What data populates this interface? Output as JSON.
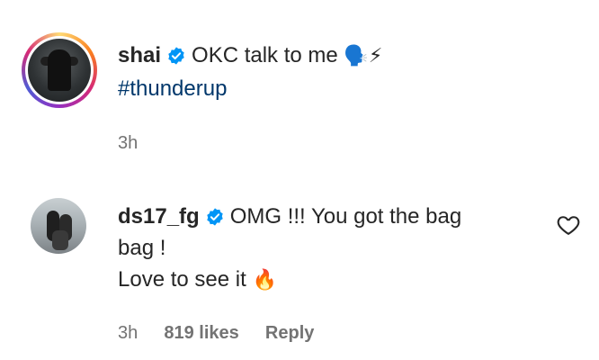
{
  "caption": {
    "username": "shai",
    "text": "OKC talk to me",
    "emoji": "🗣️⚡",
    "hashtag": "#thunderup",
    "time": "3h"
  },
  "comment": {
    "username": "ds17_fg",
    "text_line1": "OMG !!! You got the bag",
    "text_line2": "bag !",
    "text_line3": "Love to see it",
    "emoji": "🔥",
    "time": "3h",
    "likes": "819 likes",
    "reply_label": "Reply"
  },
  "colors": {
    "verified": "#0095f6",
    "hashtag": "#00376b",
    "meta": "#737373",
    "text": "#262626"
  }
}
